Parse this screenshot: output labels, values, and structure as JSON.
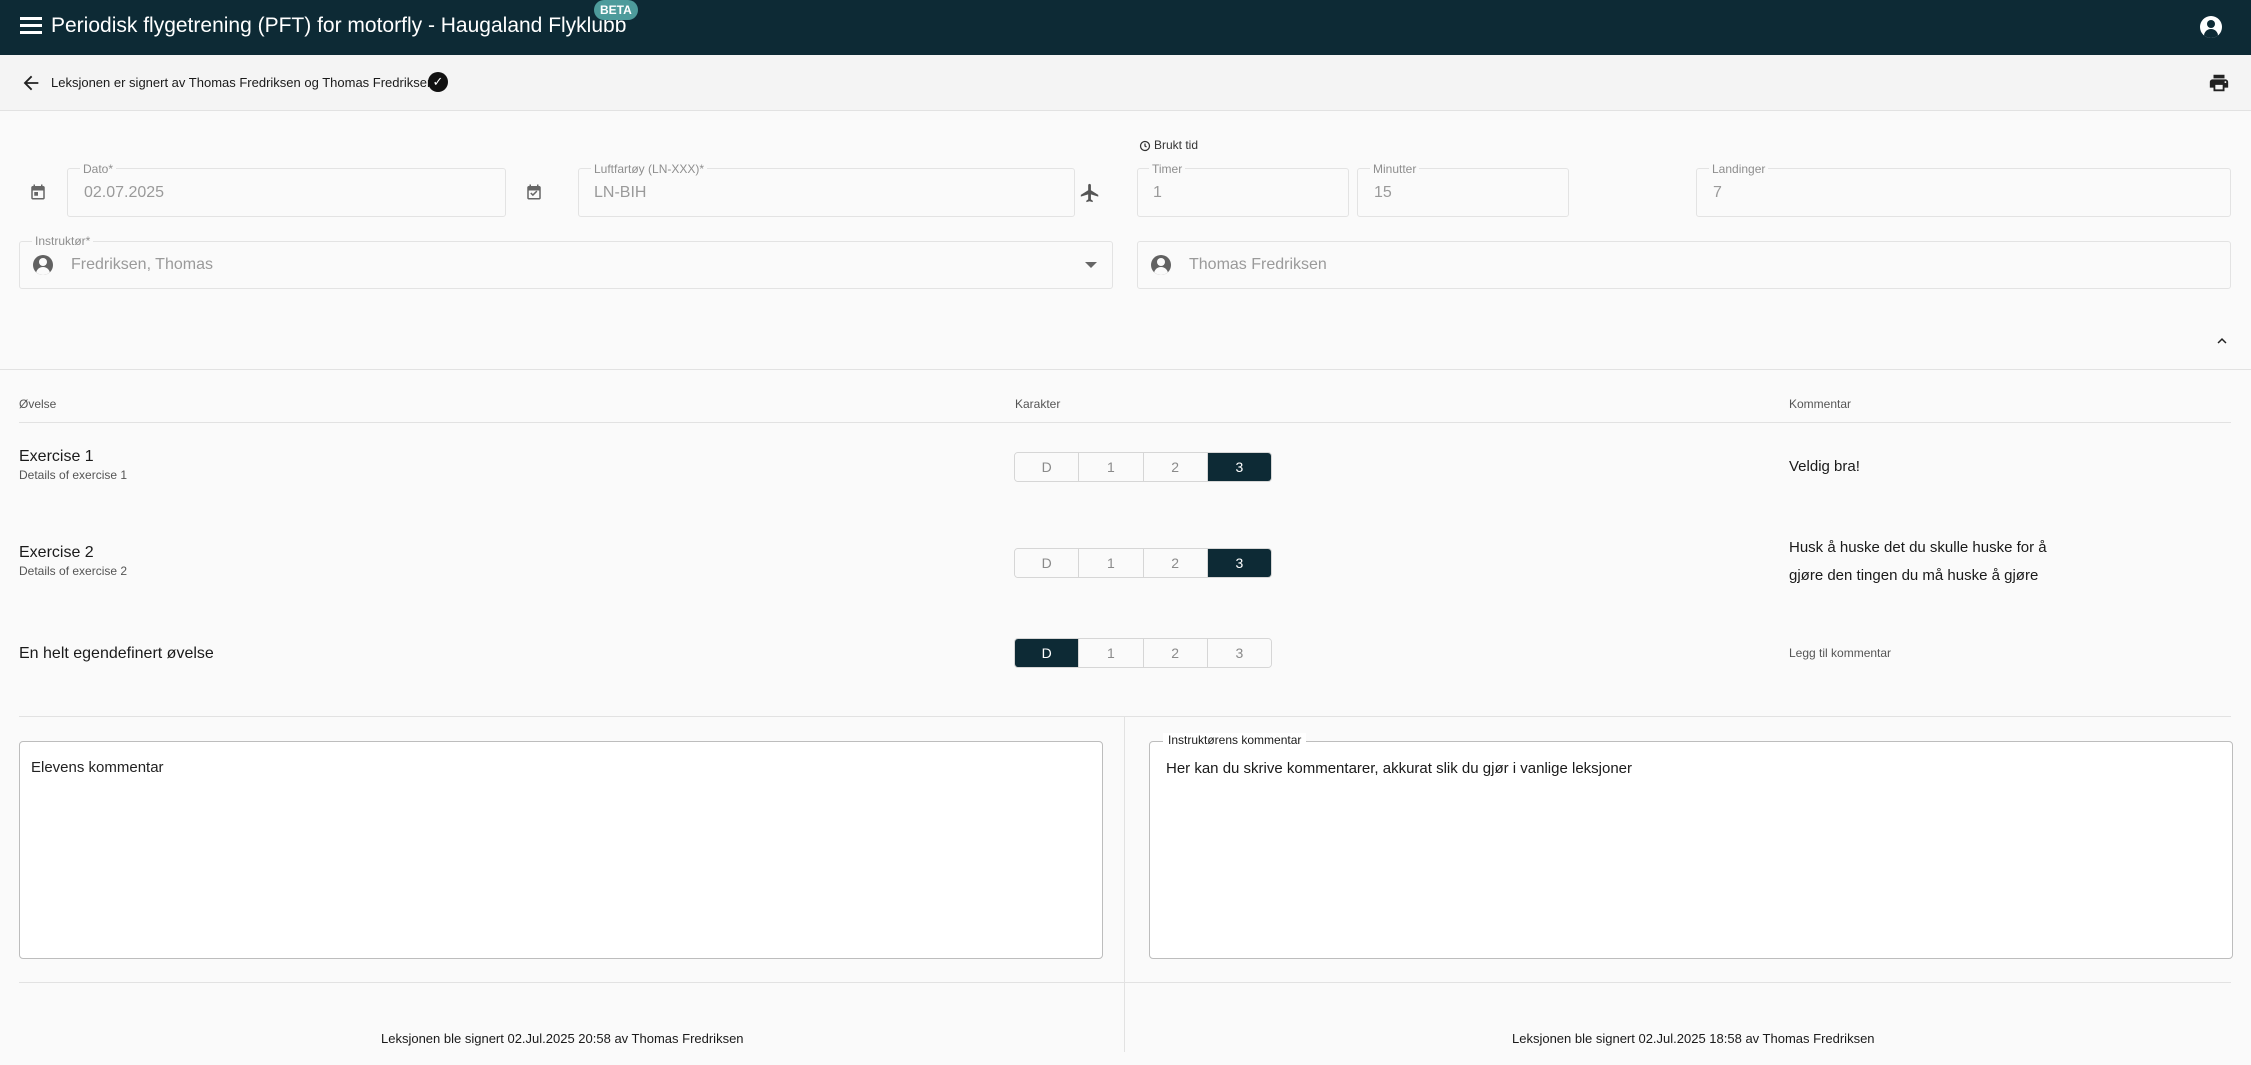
{
  "app": {
    "title": "Periodisk flygetrening (PFT) for motorfly - Haugaland Flyklubb",
    "beta_badge": "BETA"
  },
  "subheader": {
    "signed_text": "Leksjonen er signert av Thomas Fredriksen og Thomas Fredriksen"
  },
  "form": {
    "date": {
      "label": "Dato*",
      "value": "02.07.2025"
    },
    "aircraft": {
      "label": "Luftfartøy (LN-XXX)*",
      "value": "LN-BIH"
    },
    "time_used_label": "Brukt tid",
    "hours": {
      "label": "Timer",
      "value": "1"
    },
    "minutes": {
      "label": "Minutter",
      "value": "15"
    },
    "landings": {
      "label": "Landinger",
      "value": "7"
    },
    "instructor": {
      "label": "Instruktør*",
      "value": "Fredriksen, Thomas"
    },
    "student": {
      "value": "Thomas Fredriksen"
    }
  },
  "table": {
    "headers": {
      "exercise": "Øvelse",
      "grade": "Karakter",
      "comment": "Kommentar"
    },
    "grade_options": [
      "D",
      "1",
      "2",
      "3"
    ],
    "rows": [
      {
        "title": "Exercise 1",
        "details": "Details of exercise 1",
        "selected": "3",
        "comment": "Veldig bra!"
      },
      {
        "title": "Exercise 2",
        "details": "Details of exercise 2",
        "selected": "3",
        "comment": "Husk å huske det du skulle huske for å gjøre den tingen du må huske å gjøre"
      },
      {
        "title": "En helt egendefinert øvelse",
        "details": "",
        "selected": "D",
        "comment": ""
      }
    ],
    "add_comment_label": "Legg til kommentar"
  },
  "comments": {
    "student": {
      "placeholder": "Elevens kommentar"
    },
    "instructor": {
      "legend": "Instruktørens kommentar",
      "value": "Her kan du skrive kommentarer, akkurat slik du gjør i vanlige leksjoner"
    }
  },
  "signatures": {
    "student": "Leksjonen ble signert 02.Jul.2025 20:58 av Thomas Fredriksen",
    "instructor": "Leksjonen ble signert 02.Jul.2025 18:58 av Thomas Fredriksen"
  },
  "colors": {
    "primary": "#0d2a35",
    "beta": "#4d9b9b",
    "background": "#fafafa"
  },
  "icons": [
    "menu-icon",
    "account-icon",
    "arrow-back-icon",
    "check-circle-icon",
    "print-icon",
    "calendar-icon",
    "calendar-check-icon",
    "airplane-icon",
    "clock-icon",
    "person-icon",
    "dropdown-arrow-icon",
    "chevron-up-icon"
  ]
}
